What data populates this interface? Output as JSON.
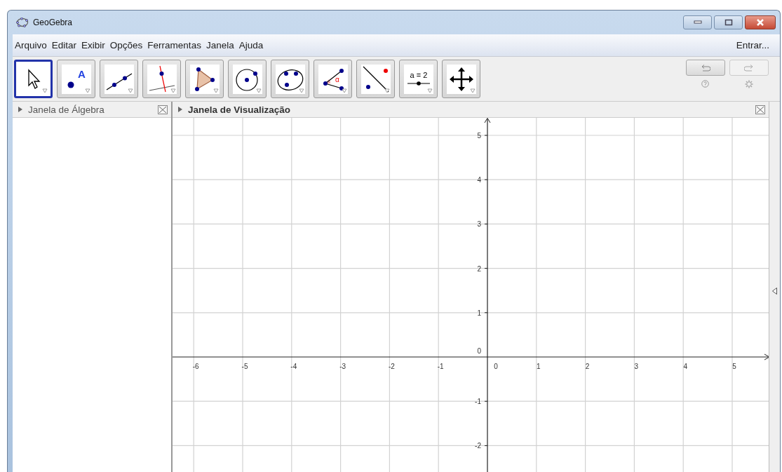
{
  "window": {
    "title": "GeoGebra"
  },
  "menu": [
    "Arquivo",
    "Editar",
    "Exibir",
    "Opções",
    "Ferramentas",
    "Janela",
    "Ajuda"
  ],
  "login": "Entrar...",
  "tools": [
    {
      "kind": "move",
      "selected": true
    },
    {
      "kind": "point",
      "label": "A",
      "selected": false
    },
    {
      "kind": "line",
      "selected": false
    },
    {
      "kind": "perpendicular",
      "selected": false
    },
    {
      "kind": "polygon",
      "selected": false
    },
    {
      "kind": "circle",
      "selected": false
    },
    {
      "kind": "conic",
      "selected": false
    },
    {
      "kind": "angle",
      "label": "α",
      "selected": false
    },
    {
      "kind": "reflect",
      "selected": false
    },
    {
      "kind": "slider",
      "label": "a = 2",
      "selected": false
    },
    {
      "kind": "pan",
      "selected": false
    }
  ],
  "algebra_view": {
    "title": "Janela de Álgebra"
  },
  "graphics_view": {
    "title": "Janela de Visualização",
    "x_ticks": [
      "-6",
      "-5",
      "-4",
      "-3",
      "-2",
      "-1",
      "0",
      "1",
      "2",
      "3",
      "4",
      "5"
    ],
    "y_ticks": [
      "5",
      "4",
      "3",
      "2",
      "1",
      "0",
      "-1",
      "-2"
    ]
  }
}
